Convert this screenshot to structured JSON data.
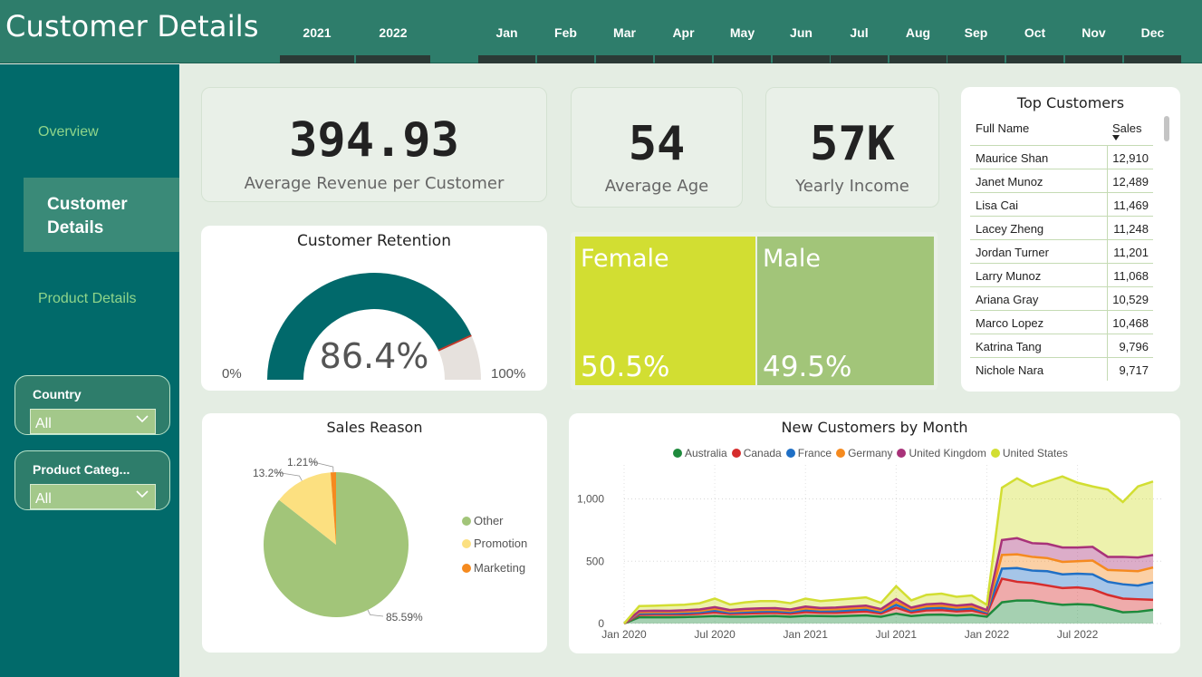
{
  "header": {
    "title": "Customer Details",
    "years": [
      "2021",
      "2022"
    ],
    "months": [
      "Jan",
      "Feb",
      "Mar",
      "Apr",
      "May",
      "Jun",
      "Jul",
      "Aug",
      "Sep",
      "Oct",
      "Nov",
      "Dec"
    ]
  },
  "nav": {
    "overview": "Overview",
    "customer_details": "Customer\nDetails",
    "product_details": "Product Details"
  },
  "filters": {
    "country": {
      "label": "Country",
      "value": "All"
    },
    "product_category": {
      "label": "Product Categ...",
      "value": "All"
    }
  },
  "kpis": {
    "avg_revenue": {
      "value": "394.93",
      "label": "Average Revenue per Customer"
    },
    "avg_age": {
      "value": "54",
      "label": "Average Age"
    },
    "yearly_income": {
      "value": "57K",
      "label": "Yearly Income"
    }
  },
  "retention": {
    "title": "Customer Retention",
    "value_text": "86.4%",
    "value": 0.864,
    "min_label": "0%",
    "max_label": "100%",
    "colors": {
      "fill": "#01696b",
      "track": "#e6e1dd",
      "target": "#c0392b"
    }
  },
  "gender": {
    "female": {
      "label": "Female",
      "pct": "50.5%",
      "color": "#d2de32"
    },
    "male": {
      "label": "Male",
      "pct": "49.5%",
      "color": "#a2c579"
    }
  },
  "top_customers": {
    "title": "Top Customers",
    "columns": [
      "Full Name",
      "Sales"
    ],
    "rows": [
      {
        "name": "Maurice Shan",
        "sales": "12,910"
      },
      {
        "name": "Janet Munoz",
        "sales": "12,489"
      },
      {
        "name": "Lisa Cai",
        "sales": "11,469"
      },
      {
        "name": "Lacey Zheng",
        "sales": "11,248"
      },
      {
        "name": "Jordan Turner",
        "sales": "11,201"
      },
      {
        "name": "Larry Munoz",
        "sales": "11,068"
      },
      {
        "name": "Ariana Gray",
        "sales": "10,529"
      },
      {
        "name": "Marco Lopez",
        "sales": "10,468"
      },
      {
        "name": "Katrina Tang",
        "sales": "9,796"
      },
      {
        "name": "Nichole Nara",
        "sales": "9,717"
      }
    ]
  },
  "chart_data": [
    {
      "type": "pie",
      "title": "Sales Reason",
      "categories": [
        "Other",
        "Promotion",
        "Marketing"
      ],
      "values": [
        85.59,
        13.2,
        1.21
      ],
      "labels": [
        "85.59%",
        "13.2%",
        "1.21%"
      ],
      "colors": [
        "#a2c579",
        "#fce080",
        "#f58a1f"
      ],
      "legend": "right"
    },
    {
      "type": "area",
      "title": "New Customers by Month",
      "stacked": true,
      "legend": "top",
      "x_ticks": [
        "Jan 2020",
        "Jul 2020",
        "Jan 2021",
        "Jul 2021",
        "Jan 2022",
        "Jul 2022"
      ],
      "y_ticks": [
        "0",
        "500",
        "1,000"
      ],
      "ylim": [
        0,
        1200
      ],
      "x": [
        "2020-01",
        "2020-02",
        "2020-03",
        "2020-04",
        "2020-05",
        "2020-06",
        "2020-07",
        "2020-08",
        "2020-09",
        "2020-10",
        "2020-11",
        "2020-12",
        "2021-01",
        "2021-02",
        "2021-03",
        "2021-04",
        "2021-05",
        "2021-06",
        "2021-07",
        "2021-08",
        "2021-09",
        "2021-10",
        "2021-11",
        "2021-12",
        "2022-01",
        "2022-02",
        "2022-03",
        "2022-04",
        "2022-05",
        "2022-06",
        "2022-07",
        "2022-08",
        "2022-09",
        "2022-10",
        "2022-11",
        "2022-12"
      ],
      "series": [
        {
          "name": "Australia",
          "color": "#1e8a3c",
          "values": [
            0,
            50,
            50,
            50,
            52,
            55,
            60,
            55,
            55,
            58,
            60,
            55,
            62,
            60,
            58,
            62,
            65,
            55,
            80,
            60,
            70,
            72,
            65,
            70,
            55,
            170,
            185,
            185,
            165,
            150,
            155,
            150,
            120,
            90,
            95,
            110
          ]
        },
        {
          "name": "Canada",
          "color": "#d62c2c",
          "values": [
            0,
            20,
            22,
            22,
            22,
            24,
            30,
            22,
            25,
            26,
            26,
            24,
            30,
            27,
            28,
            30,
            32,
            25,
            48,
            28,
            35,
            36,
            32,
            34,
            22,
            190,
            150,
            140,
            140,
            135,
            135,
            125,
            110,
            110,
            100,
            80
          ]
        },
        {
          "name": "France",
          "color": "#1f6fc5",
          "values": [
            0,
            10,
            10,
            10,
            10,
            11,
            14,
            10,
            12,
            13,
            13,
            12,
            15,
            13,
            14,
            15,
            16,
            12,
            22,
            14,
            17,
            18,
            16,
            17,
            11,
            80,
            110,
            100,
            115,
            110,
            110,
            120,
            105,
            115,
            110,
            140
          ]
        },
        {
          "name": "Germany",
          "color": "#f58a1f",
          "values": [
            0,
            10,
            10,
            10,
            11,
            11,
            14,
            10,
            12,
            12,
            12,
            11,
            14,
            12,
            14,
            14,
            15,
            12,
            22,
            13,
            16,
            17,
            15,
            16,
            10,
            110,
            110,
            110,
            105,
            100,
            100,
            110,
            95,
            110,
            115,
            120
          ]
        },
        {
          "name": "United Kingdom",
          "color": "#a83279",
          "values": [
            0,
            10,
            11,
            10,
            11,
            12,
            14,
            11,
            13,
            13,
            13,
            11,
            15,
            13,
            14,
            15,
            16,
            12,
            25,
            13,
            17,
            18,
            16,
            17,
            10,
            120,
            130,
            110,
            115,
            115,
            110,
            110,
            105,
            110,
            110,
            100
          ]
        },
        {
          "name": "United States",
          "color": "#d2de32",
          "values": [
            0,
            40,
            40,
            45,
            45,
            50,
            68,
            45,
            53,
            58,
            56,
            50,
            64,
            55,
            62,
            64,
            66,
            49,
            103,
            58,
            75,
            79,
            71,
            71,
            42,
            420,
            480,
            455,
            500,
            570,
            520,
            485,
            540,
            440,
            570,
            590
          ]
        }
      ]
    }
  ]
}
